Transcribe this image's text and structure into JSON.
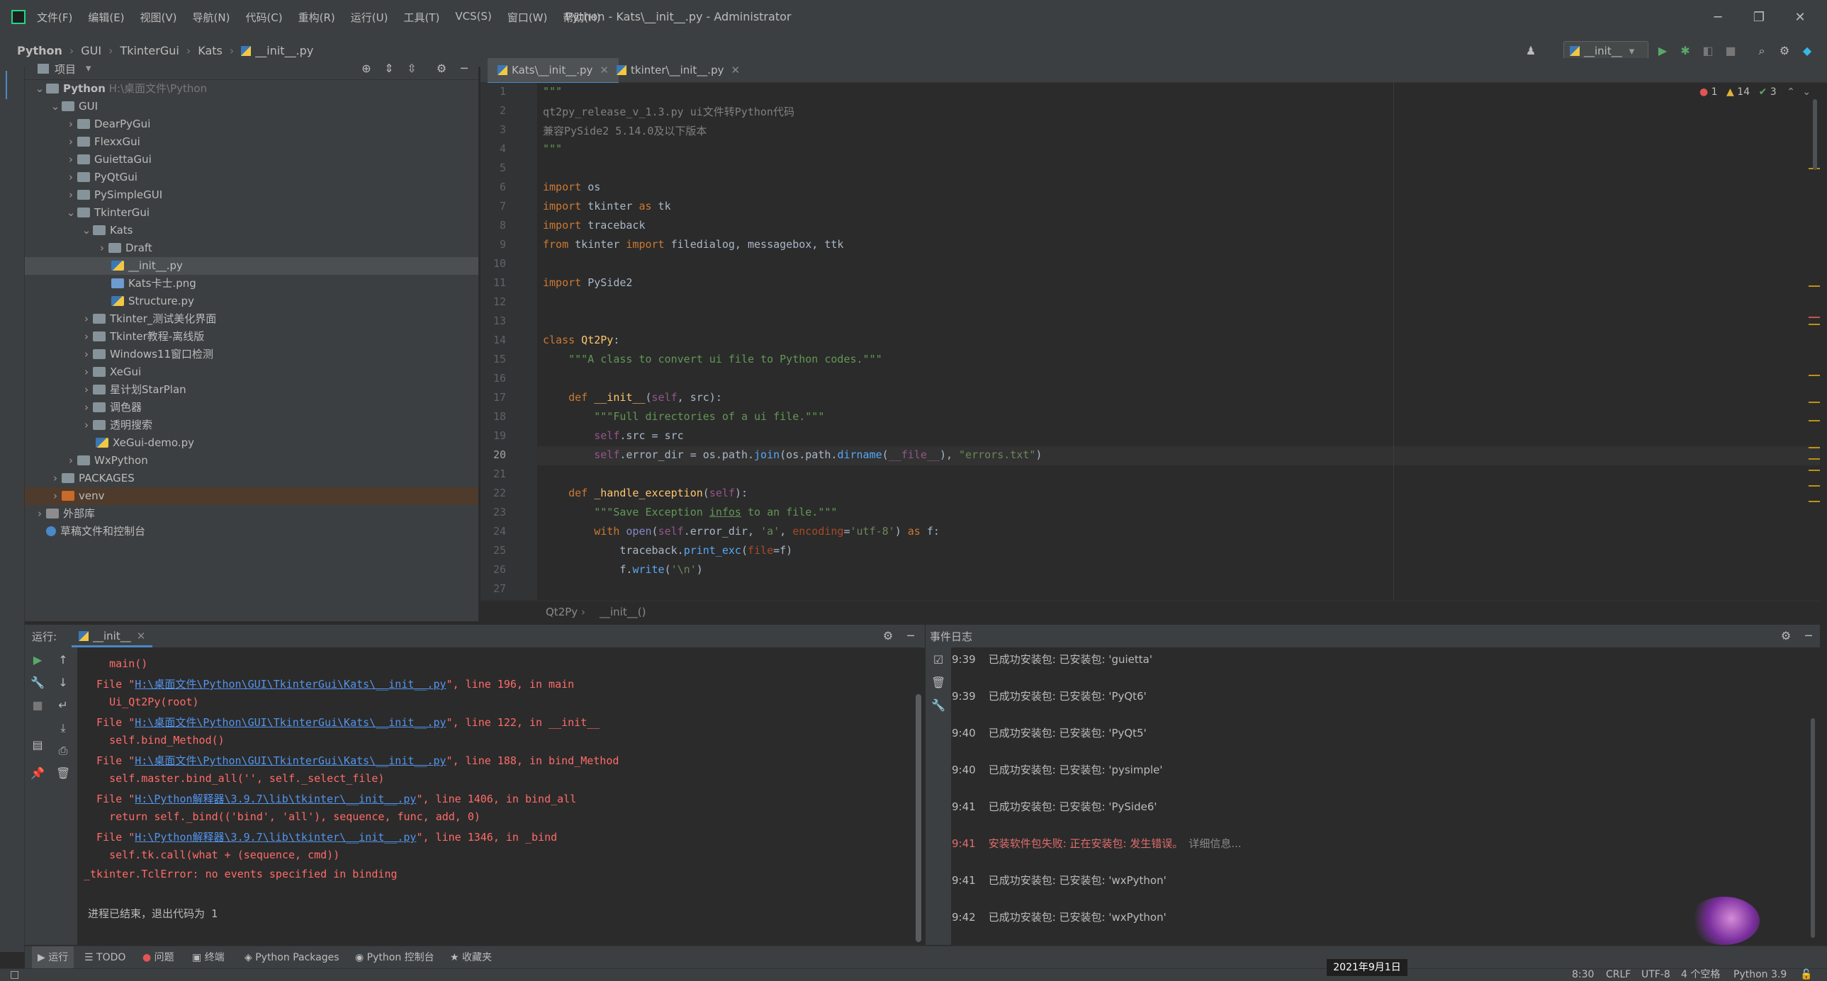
{
  "titlebar": {
    "menu": [
      "文件(F)",
      "编辑(E)",
      "视图(V)",
      "导航(N)",
      "代码(C)",
      "重构(R)",
      "运行(U)",
      "工具(T)",
      "VCS(S)",
      "窗口(W)",
      "帮助(H)"
    ],
    "title": "Python - Kats\\__init__.py - Administrator"
  },
  "breadcrumb": [
    "Python",
    "GUI",
    "TkinterGui",
    "Kats",
    "__init__.py"
  ],
  "run_config": "__init__",
  "project": {
    "header": "项目",
    "root_name": "Python",
    "root_path": "H:\\桌面文件\\Python",
    "items": [
      {
        "label": "GUI"
      },
      {
        "label": "DearPyGui"
      },
      {
        "label": "FlexxGui"
      },
      {
        "label": "GuiettaGui"
      },
      {
        "label": "PyQtGui"
      },
      {
        "label": "PySimpleGUI"
      },
      {
        "label": "TkinterGui"
      },
      {
        "label": "Kats"
      },
      {
        "label": "Draft"
      },
      {
        "label": "__init__.py"
      },
      {
        "label": "Kats卡士.png"
      },
      {
        "label": "Structure.py"
      },
      {
        "label": "Tkinter_测试美化界面"
      },
      {
        "label": "Tkinter教程-离线版"
      },
      {
        "label": "Windows11窗口检测"
      },
      {
        "label": "XeGui"
      },
      {
        "label": "星计划StarPlan"
      },
      {
        "label": "调色器"
      },
      {
        "label": "透明搜索"
      },
      {
        "label": "XeGui-demo.py"
      },
      {
        "label": "WxPython"
      },
      {
        "label": "PACKAGES"
      },
      {
        "label": "venv"
      },
      {
        "label": "外部库"
      },
      {
        "label": "草稿文件和控制台"
      }
    ]
  },
  "editor": {
    "tabs": [
      "Kats\\__init__.py",
      "tkinter\\__init__.py"
    ],
    "inspections": {
      "errors": "1",
      "warnings": "14",
      "ok": "3"
    },
    "line_numbers": [
      "1",
      "2",
      "3",
      "4",
      "5",
      "6",
      "7",
      "8",
      "9",
      "10",
      "11",
      "12",
      "13",
      "14",
      "15",
      "16",
      "17",
      "18",
      "19",
      "20",
      "21",
      "22",
      "23",
      "24",
      "25",
      "26",
      "27"
    ],
    "code": {
      "l1": "\"\"\"",
      "l2": "qt2py_release_v_1.3.py ui文件转Python代码",
      "l3": "兼容PySide2 5.14.0及以下版本",
      "l4": "\"\"\"",
      "l6a": "import",
      "l6b": " os",
      "l7a": "import",
      "l7b": " tkinter ",
      "l7c": "as",
      "l7d": " tk",
      "l8a": "import",
      "l8b": " traceback",
      "l9a": "from",
      "l9b": " tkinter ",
      "l9c": "import",
      "l9d": " filedialog, messagebox, ttk",
      "l11a": "import",
      "l11b": " PySide2",
      "l14a": "class",
      "l14b": " Qt2Py",
      "l14c": ":",
      "l15": "    \"\"\"A class to convert ui file to Python codes.\"\"\"",
      "l17a": "    def",
      "l17b": " __init__",
      "l17c": "(",
      "l17d": "self",
      "l17e": ", src):",
      "l18": "        \"\"\"Full directories of a ui file.\"\"\"",
      "l19a": "        self",
      "l19b": ".src = src",
      "l20a": "        self",
      "l20b": ".error_dir = os.path.",
      "l20c": "join",
      "l20d": "(os.path.",
      "l20e": "dirname",
      "l20f": "(",
      "l20g": "__file__",
      "l20h": "), ",
      "l20i": "\"errors.txt\"",
      "l20j": ")",
      "l22a": "    def",
      "l22b": " _handle_exception",
      "l22c": "(",
      "l22d": "self",
      "l22e": "):",
      "l23a": "        \"\"\"Save Exception ",
      "l23b": "infos",
      "l23c": " to an file.\"\"\"",
      "l24a": "        with",
      "l24b": " open",
      "l24c": "(",
      "l24d": "self",
      "l24e": ".error_dir, ",
      "l24f": "'a'",
      "l24g": ", ",
      "l24h": "encoding",
      "l24i": "=",
      "l24j": "'utf-8'",
      "l24k": ") ",
      "l24l": "as",
      "l24m": " f:",
      "l25a": "            traceback.",
      "l25b": "print_exc",
      "l25c": "(",
      "l25d": "file",
      "l25e": "=f)",
      "l26a": "            f.",
      "l26b": "write",
      "l26c": "(",
      "l26d": "'\\n'",
      "l26e": ")"
    },
    "breadcrumb": [
      "Qt2Py",
      "__init__()"
    ]
  },
  "run": {
    "label": "运行:",
    "tab": "__init__",
    "lines": [
      {
        "pre": "    main()"
      },
      {
        "pre": "  File \"",
        "link": "H:\\桌面文件\\Python\\GUI\\TkinterGui\\Kats\\__init__.py",
        "post": "\", line 196, in main"
      },
      {
        "pre": "    Ui_Qt2Py(root)"
      },
      {
        "pre": "  File \"",
        "link": "H:\\桌面文件\\Python\\GUI\\TkinterGui\\Kats\\__init__.py",
        "post": "\", line 122, in __init__"
      },
      {
        "pre": "    self.bind_Method()"
      },
      {
        "pre": "  File \"",
        "link": "H:\\桌面文件\\Python\\GUI\\TkinterGui\\Kats\\__init__.py",
        "post": "\", line 188, in bind_Method"
      },
      {
        "pre": "    self.master.bind_all('', self._select_file)"
      },
      {
        "pre": "  File \"",
        "link": "H:\\Python解释器\\3.9.7\\lib\\tkinter\\__init__.py",
        "post": "\", line 1406, in bind_all"
      },
      {
        "pre": "    return self._bind(('bind', 'all'), sequence, func, add, 0)"
      },
      {
        "pre": "  File \"",
        "link": "H:\\Python解释器\\3.9.7\\lib\\tkinter\\__init__.py",
        "post": "\", line 1346, in _bind"
      },
      {
        "pre": "    self.tk.call(what + (sequence, cmd))"
      },
      {
        "pre": "_tkinter.TclError: no events specified in binding"
      }
    ],
    "exit": "进程已结束，退出代码为 1"
  },
  "event_log": {
    "header": "事件日志",
    "entries": [
      {
        "time": "9:39",
        "msg": "已成功安装包: 已安装包: 'guietta'"
      },
      {
        "time": "9:39",
        "msg": "已成功安装包: 已安装包: 'PyQt6'"
      },
      {
        "time": "9:40",
        "msg": "已成功安装包: 已安装包: 'PyQt5'"
      },
      {
        "time": "9:40",
        "msg": "已成功安装包: 已安装包: 'pysimple'"
      },
      {
        "time": "9:41",
        "msg": "已成功安装包: 已安装包: 'PySide6'"
      },
      {
        "time": "9:41",
        "msg": "安装软件包失败: 正在安装包: 发生错误。",
        "more": "详细信息..."
      },
      {
        "time": "9:41",
        "msg": "已成功安装包: 已安装包: 'wxPython'"
      },
      {
        "time": "9:42",
        "msg": "已成功安装包: 已安装包: 'wxPython'"
      }
    ]
  },
  "toolwindows": [
    "运行",
    "TODO",
    "问题",
    "终端",
    "Python Packages",
    "Python 控制台",
    "收藏夹"
  ],
  "status": {
    "position": "8:30",
    "line_sep": "CRLF",
    "encoding": "UTF-8",
    "indent": "4 个空格",
    "interpreter": "Python 3.9"
  },
  "date_tip": "2021年9月1日",
  "colors": {
    "accent": "#4a88c7",
    "error": "#ff6b68",
    "link": "#5394ec",
    "keyword": "#cc7832"
  }
}
